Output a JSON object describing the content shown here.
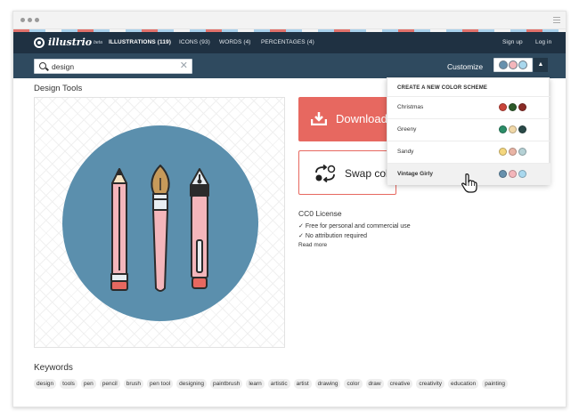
{
  "app": {
    "logo_text": "illustrio",
    "logo_sup": "beta"
  },
  "nav": {
    "tabs": [
      {
        "label": "ILLUSTRATIONS (119)",
        "active": true
      },
      {
        "label": "ICONS (93)",
        "active": false
      },
      {
        "label": "WORDS (4)",
        "active": false
      },
      {
        "label": "PERCENTAGES (4)",
        "active": false
      }
    ],
    "sign_up": "Sign up",
    "log_in": "Log in"
  },
  "search": {
    "value": "design"
  },
  "customize": {
    "label": "Customize",
    "current_swatches": [
      "#6791ad",
      "#f4b6bb",
      "#a9d8ee"
    ]
  },
  "page": {
    "title": "Design Tools"
  },
  "actions": {
    "download_label": "Download",
    "swap_label": "Swap colors"
  },
  "license": {
    "title": "CC0 License",
    "items": [
      "Free for personal and commercial use",
      "No attribution required"
    ],
    "read_more": "Read more"
  },
  "color_dropdown": {
    "header": "CREATE A NEW COLOR SCHEME",
    "schemes": [
      {
        "name": "Christmas",
        "colors": [
          "#c9453a",
          "#2d5a2a",
          "#8a2b26"
        ]
      },
      {
        "name": "Greeny",
        "colors": [
          "#2b8d68",
          "#f1d8a8",
          "#2a4a48"
        ]
      },
      {
        "name": "Sandy",
        "colors": [
          "#f5d77e",
          "#e9b4a5",
          "#b5d1d5"
        ]
      },
      {
        "name": "Vintage Girly",
        "colors": [
          "#6791ad",
          "#f4b6bb",
          "#a9d8ee"
        ],
        "hovered": true
      }
    ]
  },
  "keywords": {
    "title": "Keywords",
    "tags": [
      "design",
      "tools",
      "pen",
      "pencil",
      "brush",
      "pen tool",
      "designing",
      "paintbrush",
      "learn",
      "artistic",
      "artist",
      "drawing",
      "color",
      "draw",
      "creative",
      "creativity",
      "education",
      "painting"
    ]
  },
  "colors": {
    "nav_bg": "#1f3142",
    "subbar_bg": "#2f4a5f",
    "accent": "#e76860",
    "circle": "#5b8fad",
    "pink": "#f4b6bb"
  }
}
